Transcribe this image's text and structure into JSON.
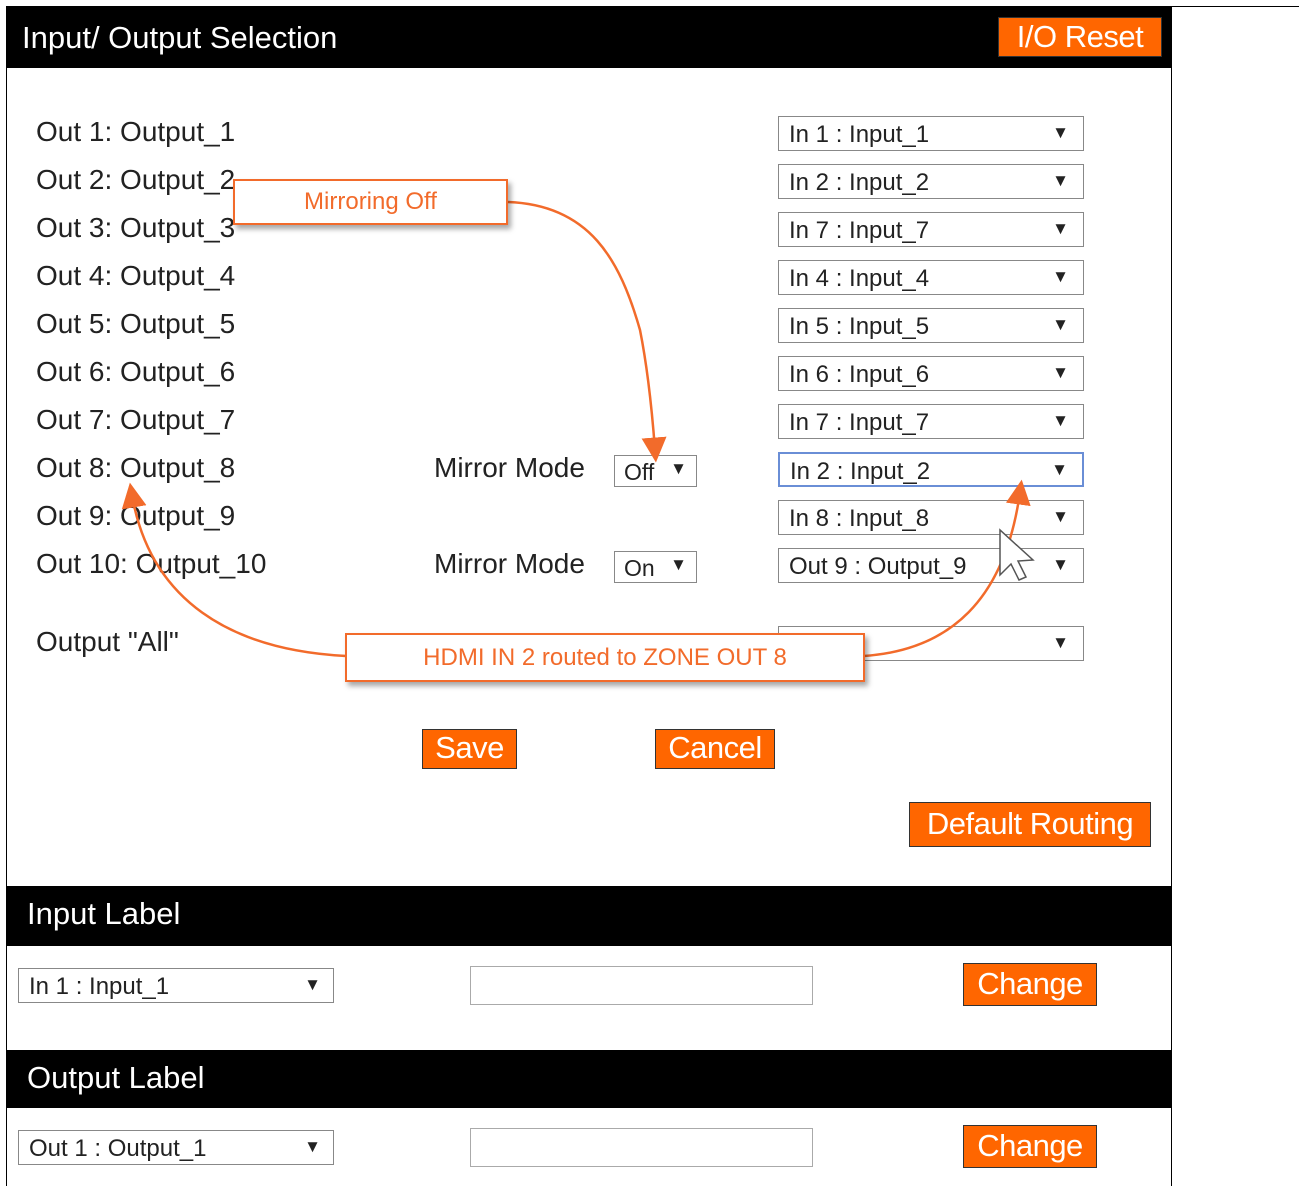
{
  "io_section": {
    "title": "Input/ Output Selection",
    "reset_button": "I/O Reset"
  },
  "outputs": [
    {
      "label": "Out 1: Output_1",
      "route": "In 1 : Input_1"
    },
    {
      "label": "Out 2: Output_2",
      "route": "In 2 : Input_2"
    },
    {
      "label": "Out 3: Output_3",
      "route": "In 7 : Input_7"
    },
    {
      "label": "Out 4: Output_4",
      "route": "In 4 : Input_4"
    },
    {
      "label": "Out 5: Output_5",
      "route": "In 5 : Input_5"
    },
    {
      "label": "Out 6: Output_6",
      "route": "In 6 : Input_6"
    },
    {
      "label": "Out 7: Output_7",
      "route": "In 7 : Input_7"
    },
    {
      "label": "Out 8: Output_8",
      "route": "In 2 : Input_2",
      "mirror_label": "Mirror Mode",
      "mirror_value": "Off"
    },
    {
      "label": "Out 9: Output_9",
      "route": "In 8 : Input_8"
    },
    {
      "label": "Out 10: Output_10",
      "route": "Out 9 : Output_9",
      "mirror_label": "Mirror Mode",
      "mirror_value": "On"
    }
  ],
  "output_all": {
    "label": "Output \"All\"",
    "route": ""
  },
  "buttons": {
    "save": "Save",
    "cancel": "Cancel",
    "default_routing": "Default Routing"
  },
  "input_label_section": {
    "title": "Input Label",
    "select_value": "In 1 : Input_1",
    "text_value": "",
    "change_button": "Change"
  },
  "output_label_section": {
    "title": "Output Label",
    "select_value": "Out 1 : Output_1",
    "text_value": "",
    "change_button": "Change"
  },
  "annotations": {
    "mirroring_off": "Mirroring Off",
    "hdmi_routed": "HDMI IN 2 routed to ZONE OUT 8"
  },
  "colors": {
    "accent": "#ff6600",
    "callout": "#f26b2b",
    "header_bg": "#000000"
  },
  "icons": {
    "dropdown": "triangle-down",
    "cursor": "mouse-pointer"
  }
}
